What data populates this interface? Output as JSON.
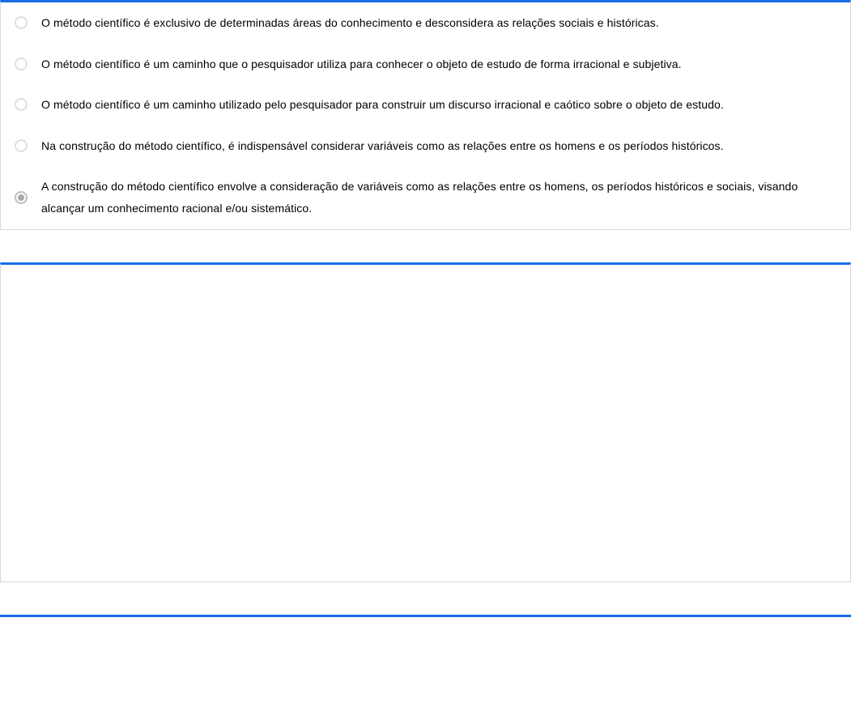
{
  "question": {
    "options": [
      {
        "text": "O método científico é exclusivo de determinadas áreas do conhecimento e desconsidera as relações sociais e históricas.",
        "selected": false
      },
      {
        "text": "O método científico é um caminho que o pesquisador utiliza para conhecer o objeto de estudo de forma irracional e subjetiva.",
        "selected": false
      },
      {
        "text": "O método científico é um caminho utilizado pelo pesquisador para construir um discurso irracional e caótico sobre o objeto de estudo.",
        "selected": false
      },
      {
        "text": "Na construção do método científico, é indispensável considerar variáveis como as relações entre os homens e os períodos históricos.",
        "selected": false
      },
      {
        "text": "A construção do método científico envolve a consideração de variáveis como as relações entre os homens, os períodos históricos e sociais, visando alcançar um conhecimento racional e/ou sistemático.",
        "selected": true
      }
    ]
  }
}
